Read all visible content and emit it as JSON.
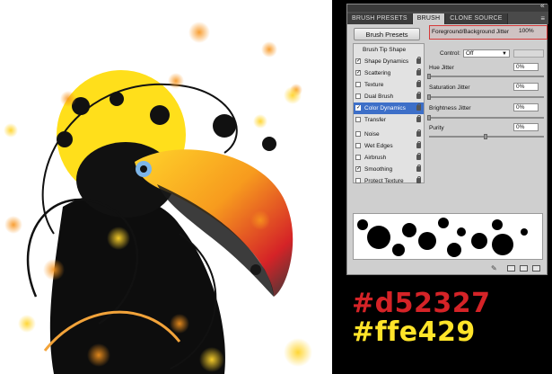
{
  "colors": {
    "accent_red": "#d52327",
    "accent_yellow": "#ffe429",
    "panel_bg": "#cfcfcf",
    "selected_blue": "#3d6fc8",
    "highlight_red": "#d63a3a"
  },
  "panel": {
    "tabs": [
      {
        "label": "BRUSH PRESETS"
      },
      {
        "label": "BRUSH"
      },
      {
        "label": "CLONE SOURCE"
      }
    ],
    "presets_button": "Brush Presets",
    "tip_shape": "Brush Tip Shape",
    "options": [
      {
        "label": "Shape Dynamics",
        "checked": "✓"
      },
      {
        "label": "Scattering",
        "checked": "✓"
      },
      {
        "label": "Texture",
        "checked": ""
      },
      {
        "label": "Dual Brush",
        "checked": ""
      },
      {
        "label": "Color Dynamics",
        "checked": "✓"
      },
      {
        "label": "Transfer",
        "checked": ""
      },
      {
        "label": "Noise",
        "checked": ""
      },
      {
        "label": "Wet Edges",
        "checked": ""
      },
      {
        "label": "Airbrush",
        "checked": ""
      },
      {
        "label": "Smoothing",
        "checked": "✓"
      },
      {
        "label": "Protect Texture",
        "checked": ""
      }
    ],
    "fg_bg_jitter": {
      "label": "Foreground/Background Jitter",
      "value": "100%"
    },
    "control": {
      "label": "Control:",
      "value": "Off"
    },
    "hue_jitter": {
      "label": "Hue Jitter",
      "value": "0%"
    },
    "saturation_jitter": {
      "label": "Saturation Jitter",
      "value": "0%"
    },
    "brightness_jitter": {
      "label": "Brightness Jitter",
      "value": "0%"
    },
    "purity": {
      "label": "Purity",
      "value": "0%"
    }
  },
  "hex_red": "#d52327",
  "hex_yellow": "#ffe429"
}
